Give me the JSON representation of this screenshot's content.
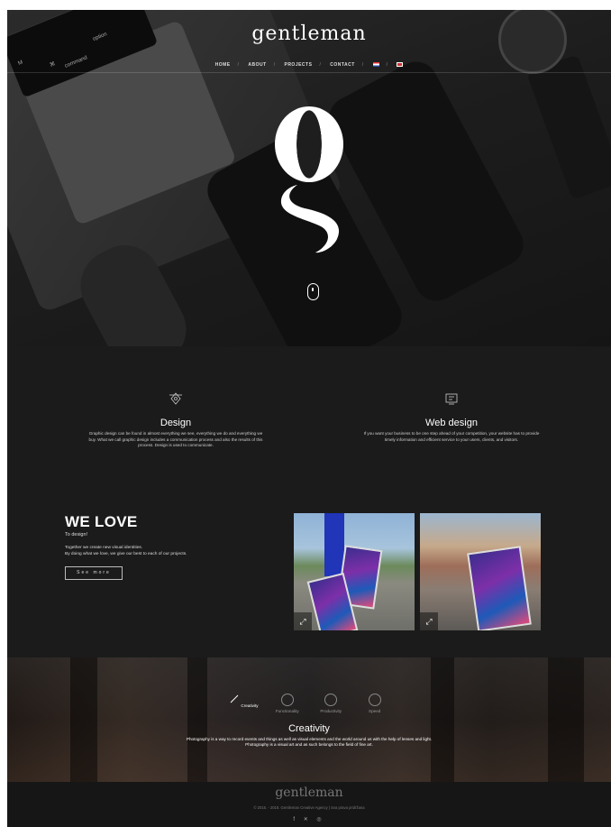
{
  "brand": {
    "logo": "gentleman",
    "logo_big_letters": [
      "o",
      "g"
    ]
  },
  "nav": {
    "items": [
      "HOME",
      "ABOUT",
      "PROJECTS",
      "CONTACT"
    ],
    "separator": "/",
    "languages": [
      "hr",
      "en"
    ]
  },
  "hero": {
    "keys": {
      "k1": "M",
      "k2": "⌘",
      "k3": "command",
      "k4": "option"
    }
  },
  "services": [
    {
      "icon": "pen-tool-icon",
      "title": "Design",
      "text": "Graphic design can be found in almost everything we see, everything we do and everything we buy. What we call graphic design includes a communication process and also the results of this process. Design is used to communicate."
    },
    {
      "icon": "monitor-code-icon",
      "title": "Web design",
      "text": "If you want your business to be one step ahead of your competition, your website has to provide timely information and efficient service to your users, clients, and visitors."
    }
  ],
  "welove": {
    "title": "WE LOVE",
    "subtitle": "To design!",
    "line1": "Together we create new visual identities.",
    "line2": "By doing what we love, we give our best to each of our projects.",
    "button": "See more"
  },
  "gallery": {
    "photos": [
      "photo-lanyard-poster",
      "photo-street-poster"
    ],
    "expand_icon": "⤢"
  },
  "creativity": {
    "tabs": [
      "Creativity",
      "Functionality",
      "Productivity",
      "Speed"
    ],
    "active_tab": 0,
    "title": "Creativity",
    "line1": "Photography is a way to record events and things as well as visual elements and the world around us with the help of lenses and light.",
    "line2": "Photography is a visual art and as such belongs to the field of fine art."
  },
  "footer": {
    "logo": "gentleman",
    "copyright": "© 2015. - 2018. Gentleman Creative Agency | Sva prava pridržana",
    "social": [
      "f",
      "✕",
      "◎"
    ]
  },
  "colors": {
    "background": "#1b1b1b",
    "text": "#ffffff",
    "muted": "#777777"
  }
}
